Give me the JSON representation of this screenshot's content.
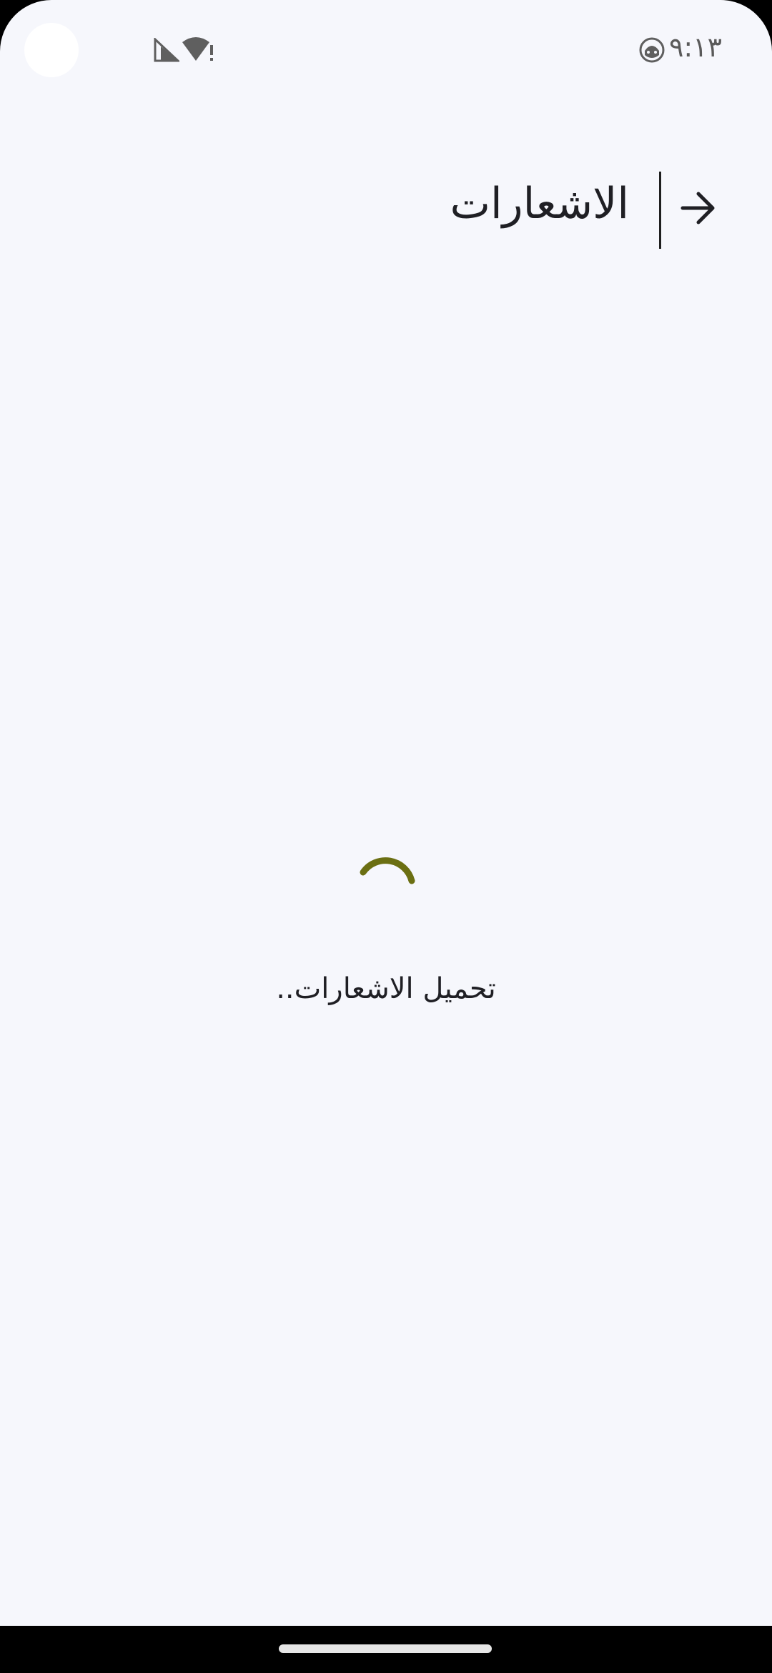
{
  "status_bar": {
    "time": "٩:١٣",
    "icons": [
      "face-icon",
      "signal-icon",
      "wifi-alert-icon"
    ]
  },
  "app_bar": {
    "title": "الاشعارات",
    "back_icon": "arrow-right-icon"
  },
  "content": {
    "loading_text": "تحميل الاشعارات..",
    "loader_color": "#6b6f12"
  },
  "colors": {
    "background": "#f6f7fc",
    "text": "#1f1f24",
    "accent": "#6b6f12"
  }
}
